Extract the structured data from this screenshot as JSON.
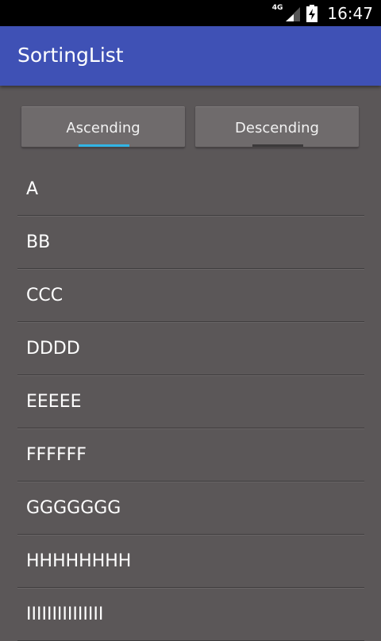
{
  "status_bar": {
    "network_label": "4G",
    "time": "16:47"
  },
  "app_bar": {
    "title": "SortingList"
  },
  "buttons": {
    "ascending_label": "Ascending",
    "descending_label": "Descending"
  },
  "list": {
    "items": [
      "A",
      "BB",
      "CCC",
      "DDDD",
      "EEEEE",
      "FFFFFF",
      "GGGGGGG",
      "HHHHHHHH",
      "IIIIIIIIIIIIIII"
    ]
  },
  "colors": {
    "app_bar": "#3f51b5",
    "status_bar": "#000000",
    "background": "#5b5758",
    "active_indicator": "#33b5e5",
    "inactive_indicator": "#3c3a3b"
  },
  "icons": [
    "signal-icon",
    "battery-icon"
  ]
}
